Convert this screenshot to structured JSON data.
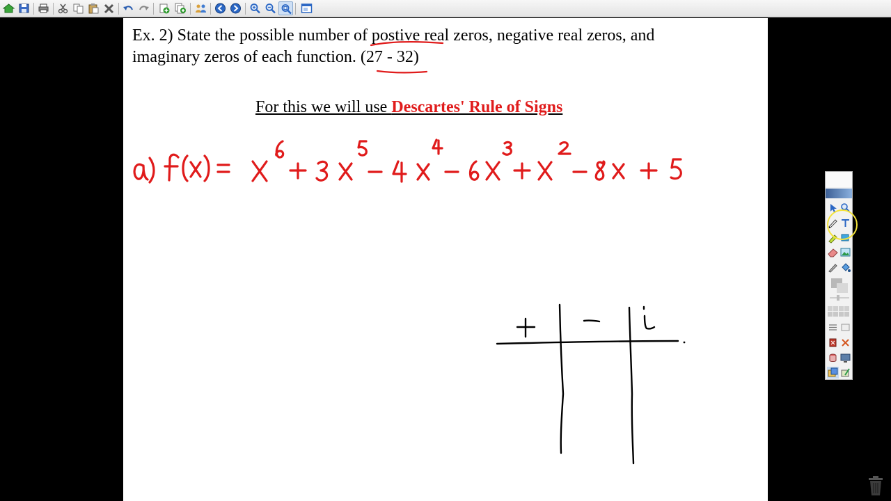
{
  "toolbar": {
    "buttons": [
      {
        "name": "home-button",
        "icon": "home-icon"
      },
      {
        "name": "save-button",
        "icon": "save-icon"
      },
      {
        "name": "print-button",
        "icon": "print-icon"
      },
      {
        "name": "cut-button",
        "icon": "scissors-icon"
      },
      {
        "name": "copy-button",
        "icon": "copy-icon"
      },
      {
        "name": "paste-button",
        "icon": "paste-icon"
      },
      {
        "name": "delete-button",
        "icon": "delete-icon"
      },
      {
        "name": "undo-button",
        "icon": "undo-icon"
      },
      {
        "name": "redo-button",
        "icon": "redo-icon"
      },
      {
        "name": "add-page-button",
        "icon": "add-page-icon"
      },
      {
        "name": "insert-page-button",
        "icon": "insert-page-icon"
      },
      {
        "name": "share-button",
        "icon": "users-icon"
      },
      {
        "name": "previous-page-button",
        "icon": "arrow-left-icon"
      },
      {
        "name": "next-page-button",
        "icon": "arrow-right-icon"
      },
      {
        "name": "zoom-in-button",
        "icon": "zoom-in-icon"
      },
      {
        "name": "zoom-out-button",
        "icon": "zoom-out-icon"
      },
      {
        "name": "zoom-fit-button",
        "icon": "zoom-fit-icon"
      },
      {
        "name": "screen-button",
        "icon": "window-icon"
      }
    ]
  },
  "page": {
    "line1": "Ex. 2) State the possible number of postive real zeros, negative real zeros, and",
    "line2": "imaginary zeros of each function. (27 - 32)",
    "line3_prefix": "For this we will use ",
    "line3_highlight": "Descartes' Rule of Signs",
    "ink_color": "#e01b1b",
    "handwritten": {
      "label": "a)",
      "equation": "f(x) = x⁶ + 3x⁵ − 4x⁴ − 6x³ + x² − 8x + 5",
      "table_headers": [
        "+",
        "−",
        "i"
      ]
    }
  },
  "palette": {
    "tools": [
      "select-icon",
      "zoom-icon",
      "pen-icon",
      "text-icon",
      "highlighter-icon",
      "shape-icon",
      "eraser-icon",
      "image-icon",
      "pencil-icon",
      "fill-icon",
      "color-icon",
      "lines-icon",
      "clear-icon",
      "delete-icon",
      "cut-icon",
      "record-icon",
      "monitor-icon",
      "gallery-icon",
      "magic-icon"
    ]
  },
  "colors": {
    "accent": "#e01b1b",
    "toolbar_bg": "#ececec",
    "page_bg": "#ffffff",
    "background": "#000000"
  }
}
